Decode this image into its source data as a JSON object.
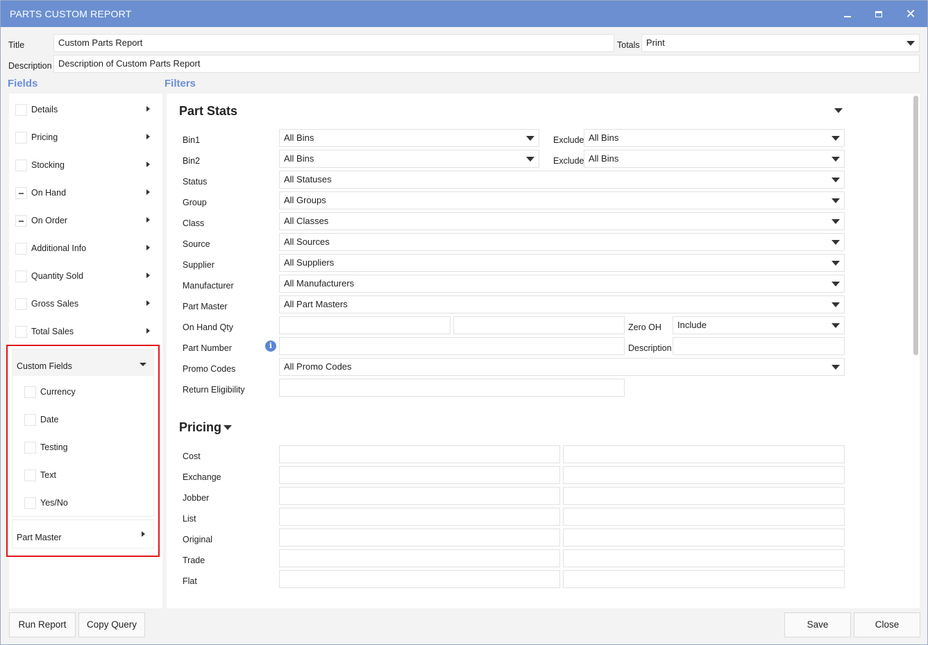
{
  "window": {
    "title": "PARTS CUSTOM REPORT"
  },
  "header": {
    "title_label": "Title",
    "title_value": "Custom Parts Report",
    "totals_label": "Totals",
    "totals_value": "Print",
    "description_label": "Description",
    "description_value": "Description of Custom Parts Report"
  },
  "fields": {
    "heading": "Fields",
    "items": [
      {
        "label": "Details",
        "state": "unchecked"
      },
      {
        "label": "Pricing",
        "state": "unchecked"
      },
      {
        "label": "Stocking",
        "state": "unchecked"
      },
      {
        "label": "On Hand",
        "state": "partial"
      },
      {
        "label": "On Order",
        "state": "partial"
      },
      {
        "label": "Additional Info",
        "state": "unchecked"
      },
      {
        "label": "Quantity Sold",
        "state": "unchecked"
      },
      {
        "label": "Gross Sales",
        "state": "unchecked"
      },
      {
        "label": "Total Sales",
        "state": "unchecked"
      }
    ],
    "custom_fields": {
      "label": "Custom Fields",
      "items": [
        "Currency",
        "Date",
        "Testing",
        "Text",
        "Yes/No"
      ]
    },
    "part_master": {
      "label": "Part Master"
    }
  },
  "filters": {
    "heading": "Filters",
    "part_stats": {
      "heading": "Part Stats",
      "bin1_label": "Bin1",
      "bin1_value": "All Bins",
      "bin1_exclude_label": "Exclude",
      "bin1_exclude_value": "All Bins",
      "bin2_label": "Bin2",
      "bin2_value": "All Bins",
      "bin2_exclude_label": "Exclude",
      "bin2_exclude_value": "All Bins",
      "status_label": "Status",
      "status_value": "All Statuses",
      "group_label": "Group",
      "group_value": "All Groups",
      "class_label": "Class",
      "class_value": "All Classes",
      "source_label": "Source",
      "source_value": "All Sources",
      "supplier_label": "Supplier",
      "supplier_value": "All Suppliers",
      "manufacturer_label": "Manufacturer",
      "manufacturer_value": "All Manufacturers",
      "part_master_label": "Part Master",
      "part_master_value": "All Part Masters",
      "on_hand_qty_label": "On Hand Qty",
      "on_hand_min": "",
      "on_hand_max": "",
      "zero_oh_label": "Zero OH",
      "zero_oh_value": "Include",
      "part_number_label": "Part Number",
      "part_number_value": "",
      "description_label": "Description",
      "description_value": "",
      "promo_codes_label": "Promo Codes",
      "promo_codes_value": "All Promo Codes",
      "return_eligibility_label": "Return Eligibility",
      "return_eligibility_value": ""
    },
    "pricing": {
      "heading": "Pricing",
      "rows": [
        "Cost",
        "Exchange",
        "Jobber",
        "List",
        "Original",
        "Trade",
        "Flat"
      ]
    }
  },
  "footer": {
    "run_report": "Run Report",
    "copy_query": "Copy Query",
    "save": "Save",
    "close": "Close"
  },
  "colors": {
    "titlebar": "#6b8fd0",
    "section_heading": "#6d8fd6",
    "highlight": "#e0161b"
  }
}
